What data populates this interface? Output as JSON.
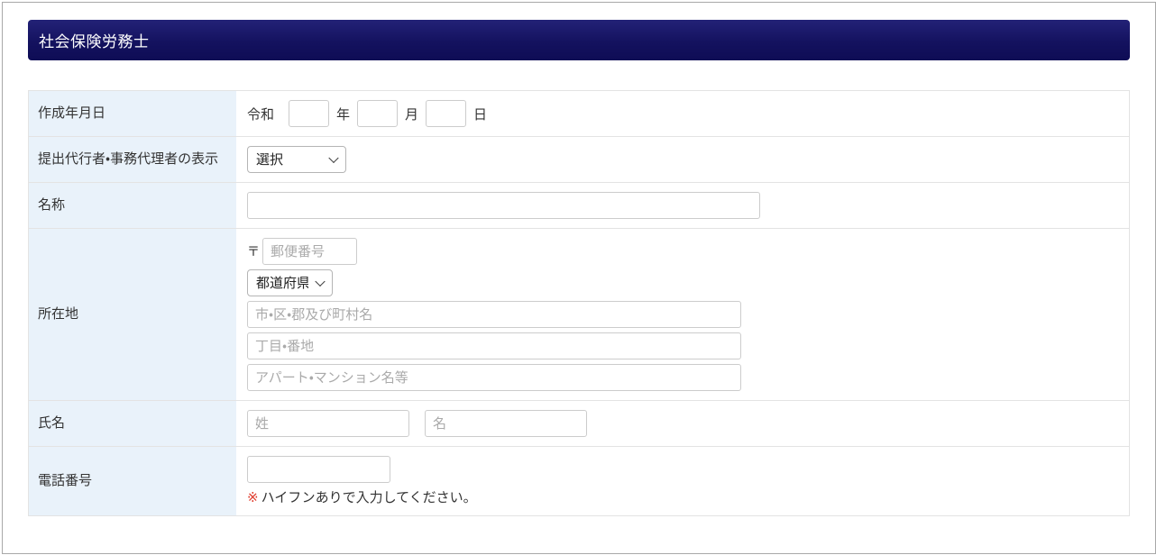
{
  "header": {
    "title": "社会保険労務士"
  },
  "colors": {
    "header_gradient_top": "#232277",
    "header_gradient_bottom": "#0e0c55",
    "label_cell_bg": "#e9f2fa",
    "table_border": "#e3e3e3",
    "note_mark_color": "#e03c2d"
  },
  "form": {
    "date_row": {
      "label": "作成年月日",
      "era_label": "令和",
      "year_value": "",
      "year_unit": "年",
      "month_value": "",
      "month_unit": "月",
      "day_value": "",
      "day_unit": "日"
    },
    "agent_row": {
      "label": "提出代行者・事務代理者の表示",
      "selected_option": "選択"
    },
    "name_row": {
      "label": "名称",
      "value": ""
    },
    "address_row": {
      "label": "所在地",
      "postal_mark": "〒",
      "postal_code": {
        "value": "",
        "placeholder": "郵便番号"
      },
      "prefecture_selected_option": "都道府県",
      "city": {
        "value": "",
        "placeholder": "市・区・郡及び町村名"
      },
      "street": {
        "value": "",
        "placeholder": "丁目・番地"
      },
      "building": {
        "value": "",
        "placeholder": "アパート・マンション名等"
      }
    },
    "fullname_row": {
      "label": "氏名",
      "last_name": {
        "value": "",
        "placeholder": "姓"
      },
      "first_name": {
        "value": "",
        "placeholder": "名"
      }
    },
    "phone_row": {
      "label": "電話番号",
      "value": "",
      "note_mark": "※",
      "note_text": "ハイフンありで入力してください。"
    }
  }
}
